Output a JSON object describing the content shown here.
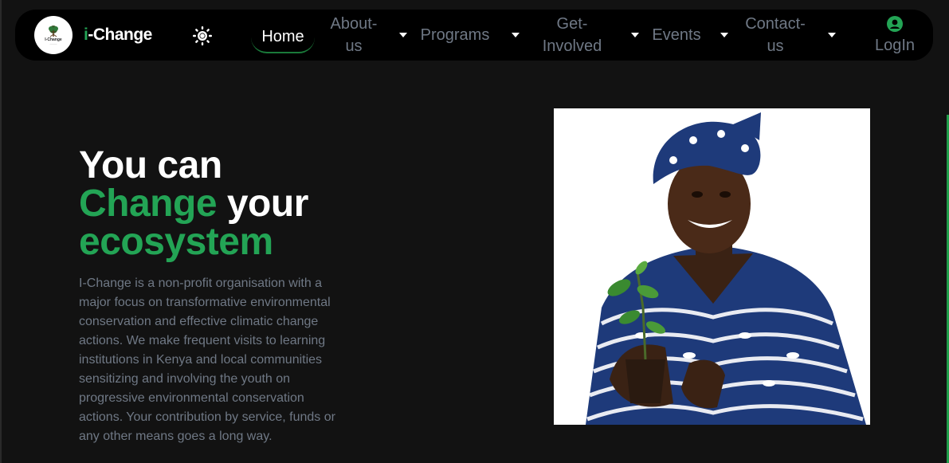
{
  "colors": {
    "background": "#121212",
    "navbar": "#000000",
    "accent_green": "#23a455",
    "muted_text": "#6f7885",
    "white": "#ffffff"
  },
  "navbar": {
    "logo_text": "I-Change",
    "brand_prefix": "i",
    "brand_rest": "-Change",
    "theme_icon": "sun-icon",
    "home_label": "Home",
    "items": [
      {
        "line1": "About-",
        "line2": "us"
      },
      {
        "line1": "Programs",
        "line2": ""
      },
      {
        "line1": "Get-",
        "line2": "Involved"
      },
      {
        "line1": "Events",
        "line2": ""
      },
      {
        "line1": "Contact-",
        "line2": "us"
      }
    ],
    "login_icon": "user-circle-icon",
    "login_label": "LogIn"
  },
  "hero": {
    "line1": "You can",
    "change_word": "Change",
    "your_word": "your",
    "ecosystem_word": "ecosystem",
    "description": "I-Change is a non-profit organisation with a major focus on transformative environmental conservation and effective climatic change actions. We make frequent visits to learning institutions in Kenya and local communities sensitizing and involving the youth on progressive environmental conservation actions. Your contribution by service, funds or any other means goes a long way.",
    "image_subject": "woman-holding-seedling-photo"
  }
}
